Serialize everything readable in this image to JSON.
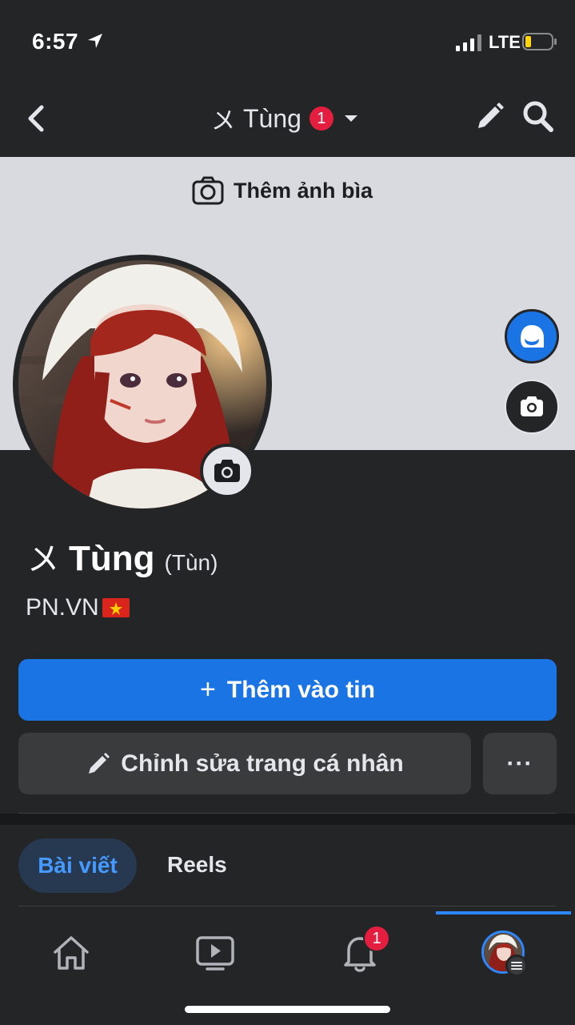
{
  "status_bar": {
    "time": "6:57",
    "network": "LTE"
  },
  "header": {
    "title_glyph": "〤",
    "title": "Tùng",
    "notification_count": "1"
  },
  "cover": {
    "add_cover_label": "Thêm ảnh bìa"
  },
  "profile": {
    "name_glyph": "〤",
    "name": "Tùng",
    "nickname": "(Tùn)",
    "bio": "PN.VN"
  },
  "actions": {
    "add_story_label": "Thêm vào tin",
    "edit_profile_label": "Chỉnh sửa trang cá nhân",
    "more_label": "···"
  },
  "tabs": [
    {
      "label": "Bài viết",
      "active": true
    },
    {
      "label": "Reels",
      "active": false
    }
  ],
  "bottom_nav": {
    "items": [
      {
        "icon": "home-icon"
      },
      {
        "icon": "video-icon"
      },
      {
        "icon": "bell-icon",
        "badge": "1"
      },
      {
        "icon": "profile-avatar",
        "active": true
      }
    ],
    "notifications_badge": "1"
  },
  "colors": {
    "accent": "#1b74e4",
    "background": "#242527",
    "badge": "#e41e3f",
    "cover": "#d8dadf"
  }
}
